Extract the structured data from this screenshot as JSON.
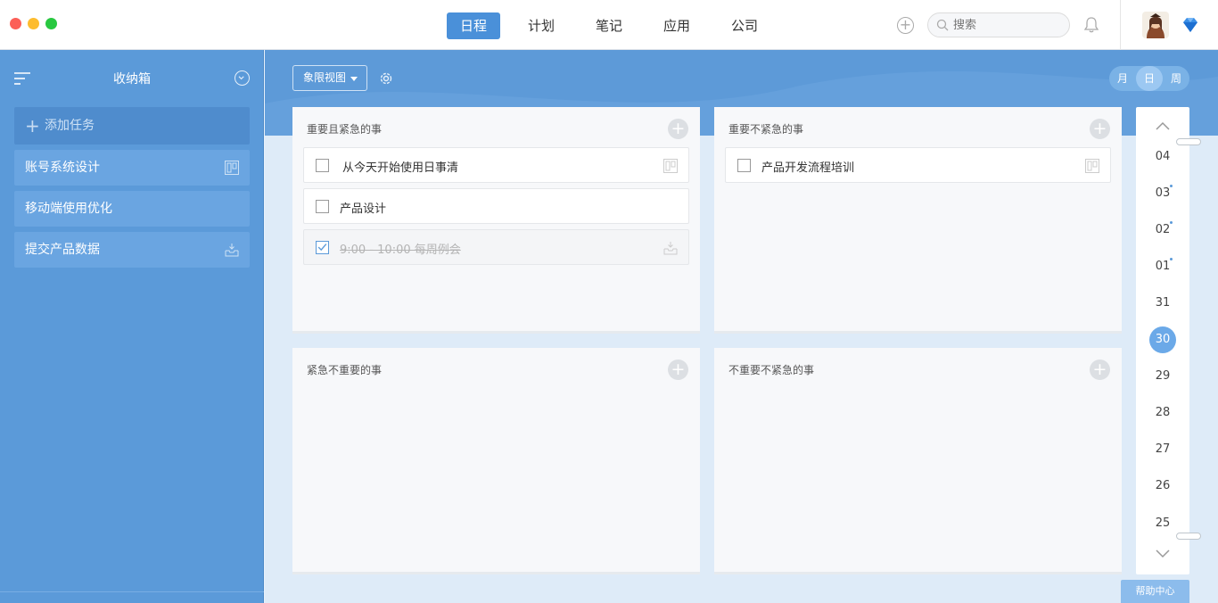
{
  "topbar": {
    "nav": [
      "日程",
      "计划",
      "笔记",
      "应用",
      "公司"
    ],
    "active_nav": "日程",
    "search_placeholder": "搜索"
  },
  "sidebar": {
    "title": "收纳箱",
    "add_task": "添加任务",
    "items": [
      {
        "label": "账号系统设计",
        "icon": "board-icon"
      },
      {
        "label": "移动端使用优化",
        "icon": ""
      },
      {
        "label": "提交产品数据",
        "icon": "inbox-icon"
      }
    ]
  },
  "main": {
    "view_button": "象限视图",
    "segments": [
      "月",
      "日",
      "周"
    ],
    "active_segment": "日",
    "quadrants": [
      {
        "title": "重要且紧急的事",
        "tasks": [
          {
            "label": "从今天开始使用日事清",
            "done": false,
            "icon": "board-icon"
          },
          {
            "label": "产品设计",
            "done": false,
            "icon": ""
          },
          {
            "label": "9:00 - 10:00 每周例会",
            "done": true,
            "icon": "inbox-icon"
          }
        ]
      },
      {
        "title": "重要不紧急的事",
        "tasks": [
          {
            "label": "产品开发流程培训",
            "done": false,
            "icon": "board-icon"
          }
        ]
      },
      {
        "title": "紧急不重要的事",
        "tasks": []
      },
      {
        "title": "不重要不紧急的事",
        "tasks": []
      }
    ],
    "dates": [
      "04",
      "03",
      "02",
      "01",
      "31",
      "30",
      "29",
      "28",
      "27",
      "26",
      "25"
    ],
    "selected_date": "30",
    "dates_with_dot": [
      "03",
      "02",
      "01"
    ],
    "help": "帮助中心"
  },
  "colors": {
    "accent": "#4a90d9",
    "sidebar": "#5b9ad9"
  }
}
